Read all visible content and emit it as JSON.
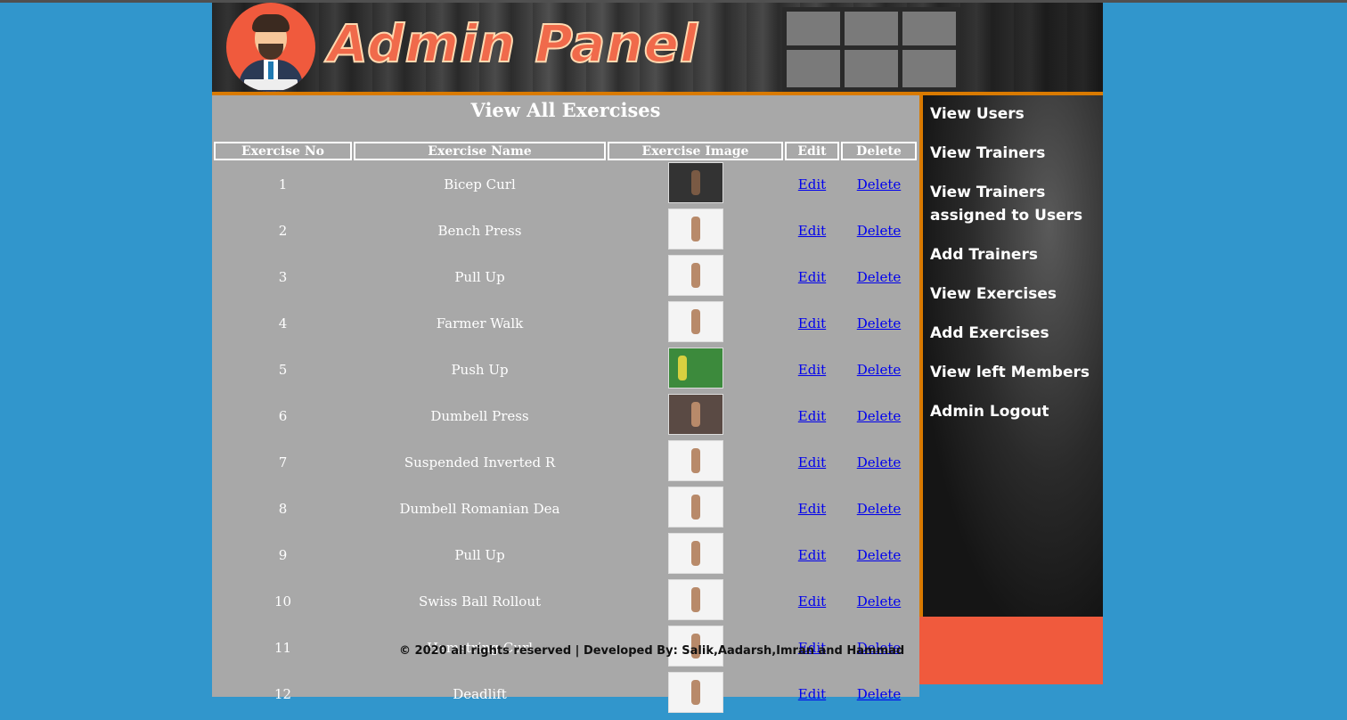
{
  "header": {
    "title": "Admin Panel"
  },
  "main": {
    "title": "View All Exercises",
    "columns": [
      "Exercise No",
      "Exercise Name",
      "Exercise Image",
      "Edit",
      "Delete"
    ],
    "rows": [
      {
        "no": "1",
        "name": "Bicep Curl",
        "edit": "Edit",
        "delete": "Delete"
      },
      {
        "no": "2",
        "name": "Bench Press",
        "edit": "Edit",
        "delete": "Delete"
      },
      {
        "no": "3",
        "name": "Pull Up",
        "edit": "Edit",
        "delete": "Delete"
      },
      {
        "no": "4",
        "name": "Farmer Walk",
        "edit": "Edit",
        "delete": "Delete"
      },
      {
        "no": "5",
        "name": "Push Up",
        "edit": "Edit",
        "delete": "Delete"
      },
      {
        "no": "6",
        "name": "Dumbell Press",
        "edit": "Edit",
        "delete": "Delete"
      },
      {
        "no": "7",
        "name": "Suspended Inverted R",
        "edit": "Edit",
        "delete": "Delete"
      },
      {
        "no": "8",
        "name": "Dumbell Romanian Dea",
        "edit": "Edit",
        "delete": "Delete"
      },
      {
        "no": "9",
        "name": "Pull Up",
        "edit": "Edit",
        "delete": "Delete"
      },
      {
        "no": "10",
        "name": "Swiss Ball Rollout",
        "edit": "Edit",
        "delete": "Delete"
      },
      {
        "no": "11",
        "name": "Hamstring Curl",
        "edit": "Edit",
        "delete": "Delete"
      },
      {
        "no": "12",
        "name": "Deadlift",
        "edit": "Edit",
        "delete": "Delete"
      }
    ]
  },
  "sidebar": {
    "items": [
      {
        "label": "View Users"
      },
      {
        "label": "View Trainers"
      },
      {
        "label": "View Trainers assigned to Users"
      },
      {
        "label": "Add Trainers"
      },
      {
        "label": "View Exercises"
      },
      {
        "label": "Add Exercises"
      },
      {
        "label": "View left Members"
      },
      {
        "label": "Admin Logout"
      }
    ]
  },
  "footer": {
    "text": "© 2020 all rights reserved | Developed By: Salik,Aadarsh,Imran and Hammad"
  },
  "colors": {
    "page_bg": "#3196cc",
    "accent_orange": "#d97a00",
    "brand": "#f05a3d",
    "panel_gray": "#a8a8a8",
    "link": "#0000ee"
  }
}
